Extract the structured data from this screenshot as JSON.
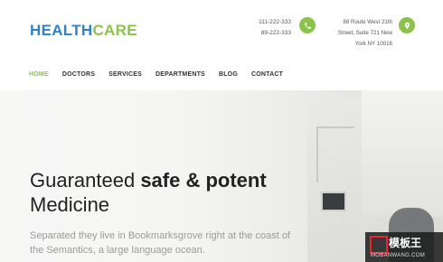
{
  "header": {
    "logo_part1": "HEALTH",
    "logo_part2": "CARE",
    "phone1": "111-222-333",
    "phone2": "89-222-333",
    "address_line1": "88 Route West 21th",
    "address_line2": "Street, Suite 721 New",
    "address_line3": "York NY 10016",
    "accent_color": "#8bc34a",
    "brand_color": "#2f82c9",
    "phone_icon": "phone-icon",
    "location_icon": "map-marker-icon"
  },
  "nav": {
    "items": [
      "HOME",
      "DOCTORS",
      "SERVICES",
      "DEPARTMENTS",
      "BLOG",
      "CONTACT"
    ],
    "active": "HOME"
  },
  "hero": {
    "headline_normal": "Guaranteed ",
    "headline_bold": "safe & potent",
    "headline_line2": "Medicine",
    "lead": "Separated they live in Bookmarksgrove right at the coast of the Semantics, a large language ocean."
  },
  "watermark": {
    "title": "模板王",
    "url": "MOBANWANG.COM"
  }
}
